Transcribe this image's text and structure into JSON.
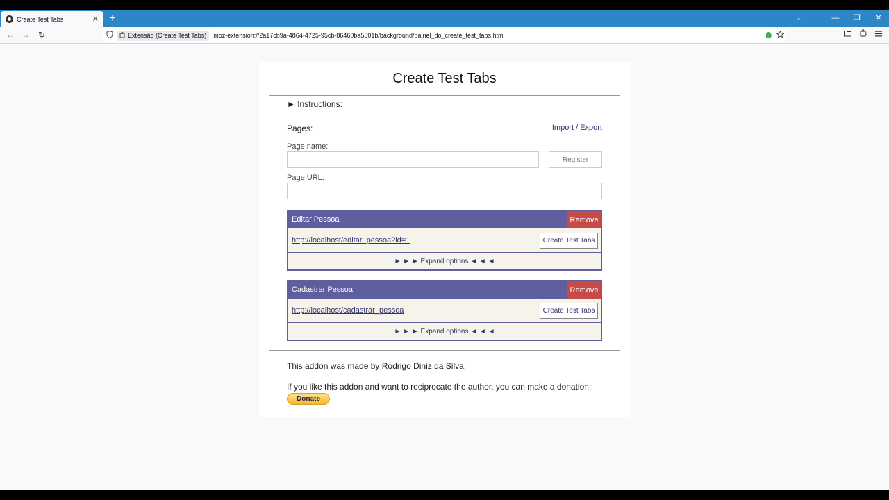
{
  "browser": {
    "tab_title": "Create Test Tabs",
    "tab_close": "✕",
    "new_tab": "+",
    "controls": {
      "list": "⌄",
      "minimize": "—",
      "restore": "❐",
      "close": "✕"
    },
    "nav": {
      "back": "←",
      "forward": "→",
      "reload": "↻"
    },
    "identity_label": "Extensão (Create Test Tabs)",
    "url": "moz-extension://2a17cb9a-4864-4725-95cb-86460ba5501b/background/painel_do_create_test_tabs.html",
    "icons": [
      "shield-icon",
      "puzzle-icon",
      "star-icon",
      "folder-icon",
      "extensions-icon",
      "menu-icon"
    ]
  },
  "page": {
    "title": "Create Test Tabs",
    "instructions": "► Instructions:",
    "pages_label": "Pages:",
    "import_export": "Import / Export",
    "page_name_label": "Page name:",
    "page_name_value": "",
    "page_url_label": "Page URL:",
    "page_url_value": "",
    "register_label": "Register",
    "cards": [
      {
        "name": "Editar Pessoa",
        "remove_label": "Remove",
        "url": "http://localhost/editar_pessoa?id=1",
        "cta_label": "Create Test Tabs",
        "expand_label": "► ► ► Expand options ◄ ◄ ◄"
      },
      {
        "name": "Cadastrar Pessoa",
        "remove_label": "Remove",
        "url": "http://localhost/cadastrar_pessoa",
        "cta_label": "Create Test Tabs",
        "expand_label": "► ► ► Expand options ◄ ◄ ◄"
      }
    ],
    "credit": "This addon was made by Rodrigo Diniz da Silva.",
    "donate_text": "If you like this addon and want to reciprocate the author, you can make a donation:",
    "donate_label": "Donate"
  },
  "colors": {
    "tabbar": "#2d87c6",
    "card_header": "#5f5fa0",
    "remove": "#c64a47",
    "card_body": "#f6f3ea"
  }
}
